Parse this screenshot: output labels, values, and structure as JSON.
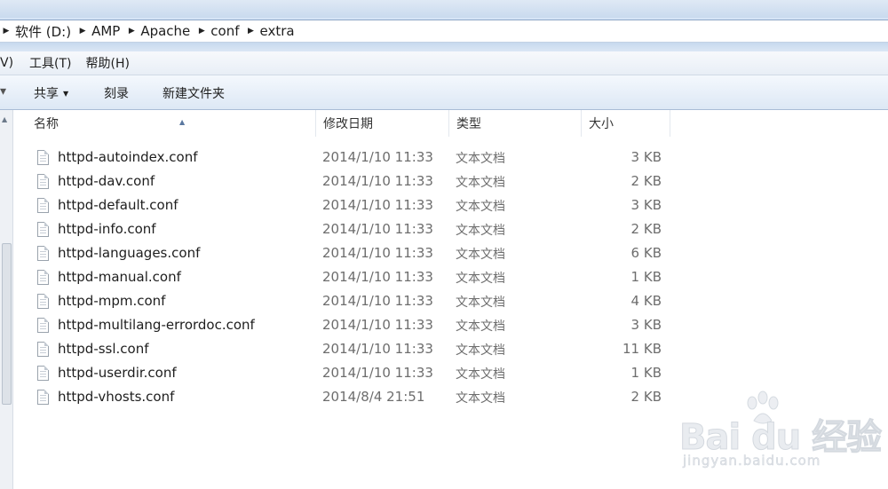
{
  "address": {
    "crumbs": [
      "软件 (D:)",
      "AMP",
      "Apache",
      "conf",
      "extra"
    ]
  },
  "menu": {
    "items": [
      "V)",
      "工具(T)",
      "帮助(H)"
    ]
  },
  "toolbar": {
    "share_label": "共享",
    "burn_label": "刻录",
    "new_folder_label": "新建文件夹"
  },
  "columns": {
    "name": "名称",
    "date": "修改日期",
    "type": "类型",
    "size": "大小"
  },
  "files": [
    {
      "name": "httpd-autoindex.conf",
      "date": "2014/1/10 11:33",
      "type": "文本文档",
      "size": "3 KB"
    },
    {
      "name": "httpd-dav.conf",
      "date": "2014/1/10 11:33",
      "type": "文本文档",
      "size": "2 KB"
    },
    {
      "name": "httpd-default.conf",
      "date": "2014/1/10 11:33",
      "type": "文本文档",
      "size": "3 KB"
    },
    {
      "name": "httpd-info.conf",
      "date": "2014/1/10 11:33",
      "type": "文本文档",
      "size": "2 KB"
    },
    {
      "name": "httpd-languages.conf",
      "date": "2014/1/10 11:33",
      "type": "文本文档",
      "size": "6 KB"
    },
    {
      "name": "httpd-manual.conf",
      "date": "2014/1/10 11:33",
      "type": "文本文档",
      "size": "1 KB"
    },
    {
      "name": "httpd-mpm.conf",
      "date": "2014/1/10 11:33",
      "type": "文本文档",
      "size": "4 KB"
    },
    {
      "name": "httpd-multilang-errordoc.conf",
      "date": "2014/1/10 11:33",
      "type": "文本文档",
      "size": "3 KB"
    },
    {
      "name": "httpd-ssl.conf",
      "date": "2014/1/10 11:33",
      "type": "文本文档",
      "size": "11 KB"
    },
    {
      "name": "httpd-userdir.conf",
      "date": "2014/1/10 11:33",
      "type": "文本文档",
      "size": "1 KB"
    },
    {
      "name": "httpd-vhosts.conf",
      "date": "2014/8/4 21:51",
      "type": "文本文档",
      "size": "2 KB"
    }
  ],
  "watermark": {
    "logo": "Bai du 经验",
    "url": "jingyan.baidu.com"
  }
}
